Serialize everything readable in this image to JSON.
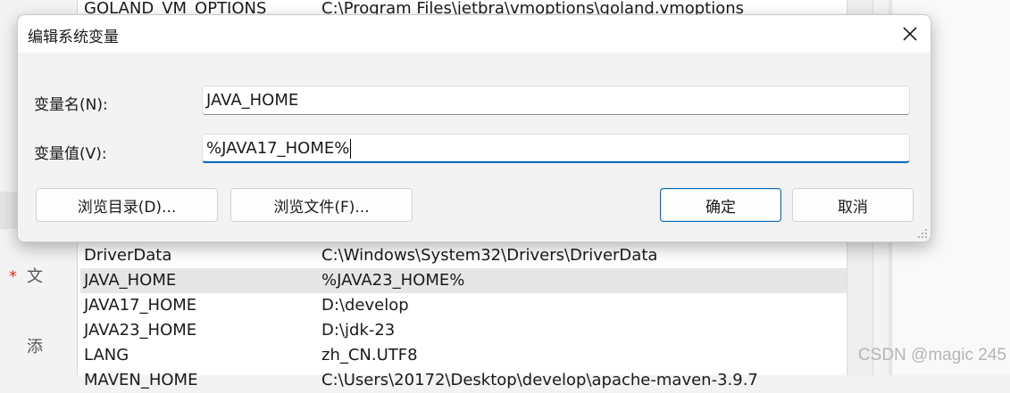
{
  "background": {
    "side_chars": [
      "文",
      "添"
    ],
    "rows": [
      {
        "name": "GOLAND_VM_OPTIONS",
        "value": "C:\\Program Files\\jetbra\\vmoptions\\goland.vmoptions",
        "selected": false
      },
      {
        "name": "DriverData",
        "value": "C:\\Windows\\System32\\Drivers\\DriverData",
        "selected": false
      },
      {
        "name": "JAVA_HOME",
        "value": "%JAVA23_HOME%",
        "selected": true
      },
      {
        "name": "JAVA17_HOME",
        "value": "D:\\develop",
        "selected": false
      },
      {
        "name": "JAVA23_HOME",
        "value": "D:\\jdk-23",
        "selected": false
      },
      {
        "name": "LANG",
        "value": "zh_CN.UTF8",
        "selected": false
      },
      {
        "name": "MAVEN_HOME",
        "value": "C:\\Users\\20172\\Desktop\\develop\\apache-maven-3.9.7",
        "selected": false
      }
    ],
    "watermark": "CSDN @magic 245"
  },
  "dialog": {
    "title": "编辑系统变量",
    "name_label": "变量名(N):",
    "name_value": "JAVA_HOME",
    "value_label": "变量值(V):",
    "value_value": "%JAVA17_HOME%",
    "buttons": {
      "browse_dir": "浏览目录(D)...",
      "browse_file": "浏览文件(F)...",
      "ok": "确定",
      "cancel": "取消"
    }
  }
}
